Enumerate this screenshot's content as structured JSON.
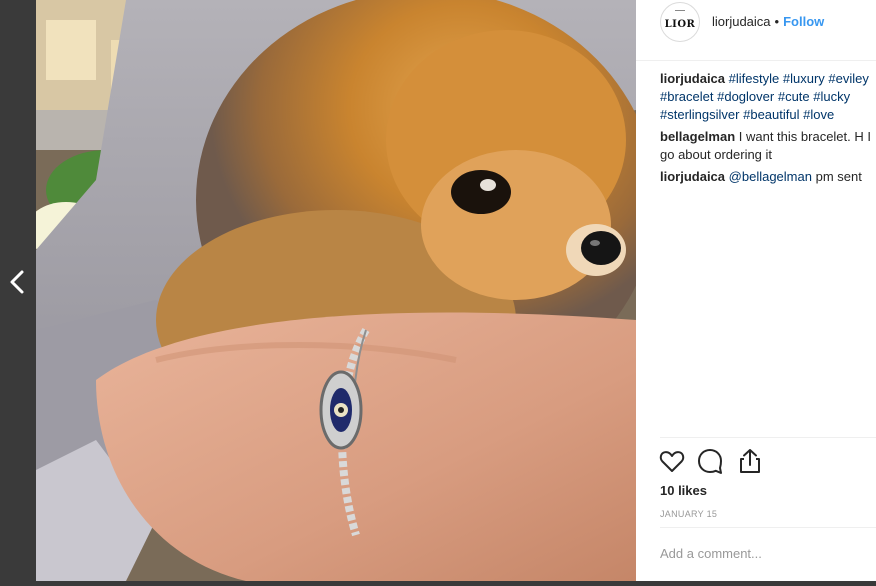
{
  "navigation": {
    "prev_icon": "chevron-left-icon"
  },
  "photo": {
    "subject": "pomeranian-and-bracelet-photo"
  },
  "header": {
    "avatar_text": "LIOR",
    "username": "liorjudaica",
    "separator": "•",
    "follow_label": "Follow"
  },
  "caption": {
    "author": "liorjudaica",
    "tags": [
      "#lifestyle",
      "#luxury",
      "#eviley",
      "#bracelet",
      "#doglover",
      "#cute",
      "#lucky",
      "#sterlingsilver",
      "#beautiful",
      "#love"
    ]
  },
  "comments": [
    {
      "author": "bellagelman",
      "text": "I want this bracelet. H I go about ordering it"
    },
    {
      "author": "liorjudaica",
      "mention": "@bellagelman",
      "text": "pm sent"
    }
  ],
  "actions": {
    "like_icon": "heart-icon",
    "comment_icon": "comment-icon",
    "share_icon": "share-icon"
  },
  "likes": "10 likes",
  "date": "JANUARY 15",
  "add_comment_placeholder": "Add a comment..."
}
